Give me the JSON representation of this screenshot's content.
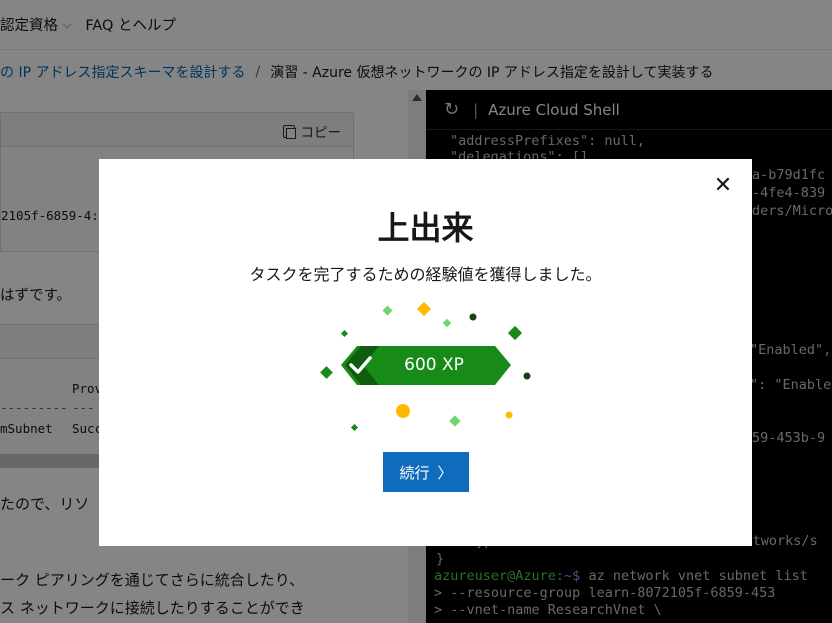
{
  "topnav": {
    "items": [
      {
        "label": "認定資格",
        "chevron": "⌵"
      },
      {
        "label": "FAQ とヘルプ"
      }
    ]
  },
  "breadcrumb": {
    "link": "の IP アドレス指定スキーマを設計する",
    "separator": "/",
    "current": "演習 - Azure 仮想ネットワークの IP アドレス指定を設計して実装する"
  },
  "content": {
    "copy_label": "コピー",
    "code_line": "2105f-6859-4:",
    "para1": "はずです。",
    "table": {
      "col_header": "Prov",
      "dashes_left": "---------",
      "dashes_right": "---",
      "row_left": "mSubnet",
      "row_right": "Succ"
    },
    "para2": "たので、リソ",
    "para3_line1": "ーク ピアリングを通じてさらに統合したり、",
    "para3_line2": "ス ネットワークに接続したりすることができ"
  },
  "shell": {
    "title": "Azure Cloud Shell",
    "lines": [
      "\"addressPrefixes\": null,",
      "\"delegations\": [],",
      "a-b79d1fc",
      "-4fe4-839",
      "ders/Micro",
      "\"Enabled\",",
      "\": \"Enable",
      "59-453b-9",
      "\"type\": \"Microsoft.Network/virtualNetworks/s",
      "}",
      "     --resource-group learn-8072105f-6859-453",
      "     --vnet-name ResearchVnet \\"
    ],
    "prompt_user": "azureuser@Azure",
    "prompt_path": ":~$",
    "prompt_cmd": " az network vnet subnet list",
    "continuation": ">"
  },
  "modal": {
    "title": "上出来",
    "subtitle": "タスクを完了するための経験値を獲得しました。",
    "xp": "600 XP",
    "continue_label": "続行",
    "continue_arrow": "〉",
    "close": "✕"
  },
  "colors": {
    "badge_green": "#188a18",
    "badge_dark": "#0f5c0f",
    "confetti_light_green": "#6fd66f",
    "confetti_gold": "#ffb900",
    "confetti_dark": "#1a3d1a",
    "button_blue": "#0f6cbd"
  }
}
